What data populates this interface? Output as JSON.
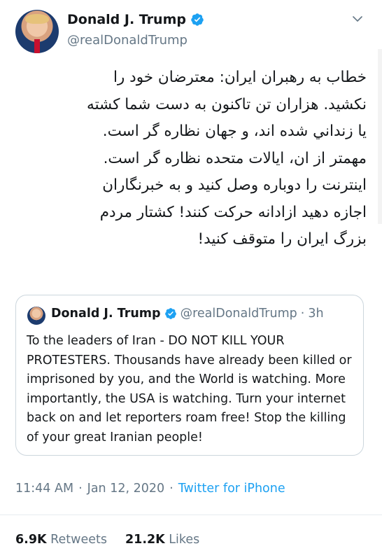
{
  "author": {
    "name": "Donald J. Trump",
    "handle": "@realDonaldTrump",
    "verified_icon": "verified-badge-icon",
    "menu_icon": "chevron-down-icon"
  },
  "tweet": {
    "text": "خطاب به رهبران ایران: معترضان خود را\nنکشید. هزاران تن تاکنون به دست شما کشته\nيا زنداني شده اند، و جهان نظاره گر است.\nمهمتر از ان، ایالات متحده نظاره گر است.\nاینترنت را دوباره وصل کنید و به خبرنگاران\nاجازه دهید ازادانه حرکت کنند! کشتار مردم\nبزرگ ایران را متوقف کنید!"
  },
  "quote": {
    "name": "Donald J. Trump",
    "handle": "@realDonaldTrump",
    "separator": "·",
    "time": "3h",
    "text": "To the leaders of Iran - DO NOT KILL YOUR PROTESTERS. Thousands have already been killed or imprisoned by you, and the World is watching. More importantly, the USA is watching. Turn your internet back on and let reporters roam free! Stop the killing of your great Iranian people!"
  },
  "meta": {
    "time": "11:44 AM",
    "sep1": "·",
    "date": "Jan 12, 2020",
    "sep2": "·",
    "source": "Twitter for iPhone"
  },
  "stats": {
    "retweets_count": "6.9K",
    "retweets_label": "Retweets",
    "likes_count": "21.2K",
    "likes_label": "Likes"
  },
  "colors": {
    "link": "#1da1f2",
    "secondary": "#657786",
    "border": "#ccd6dd"
  }
}
